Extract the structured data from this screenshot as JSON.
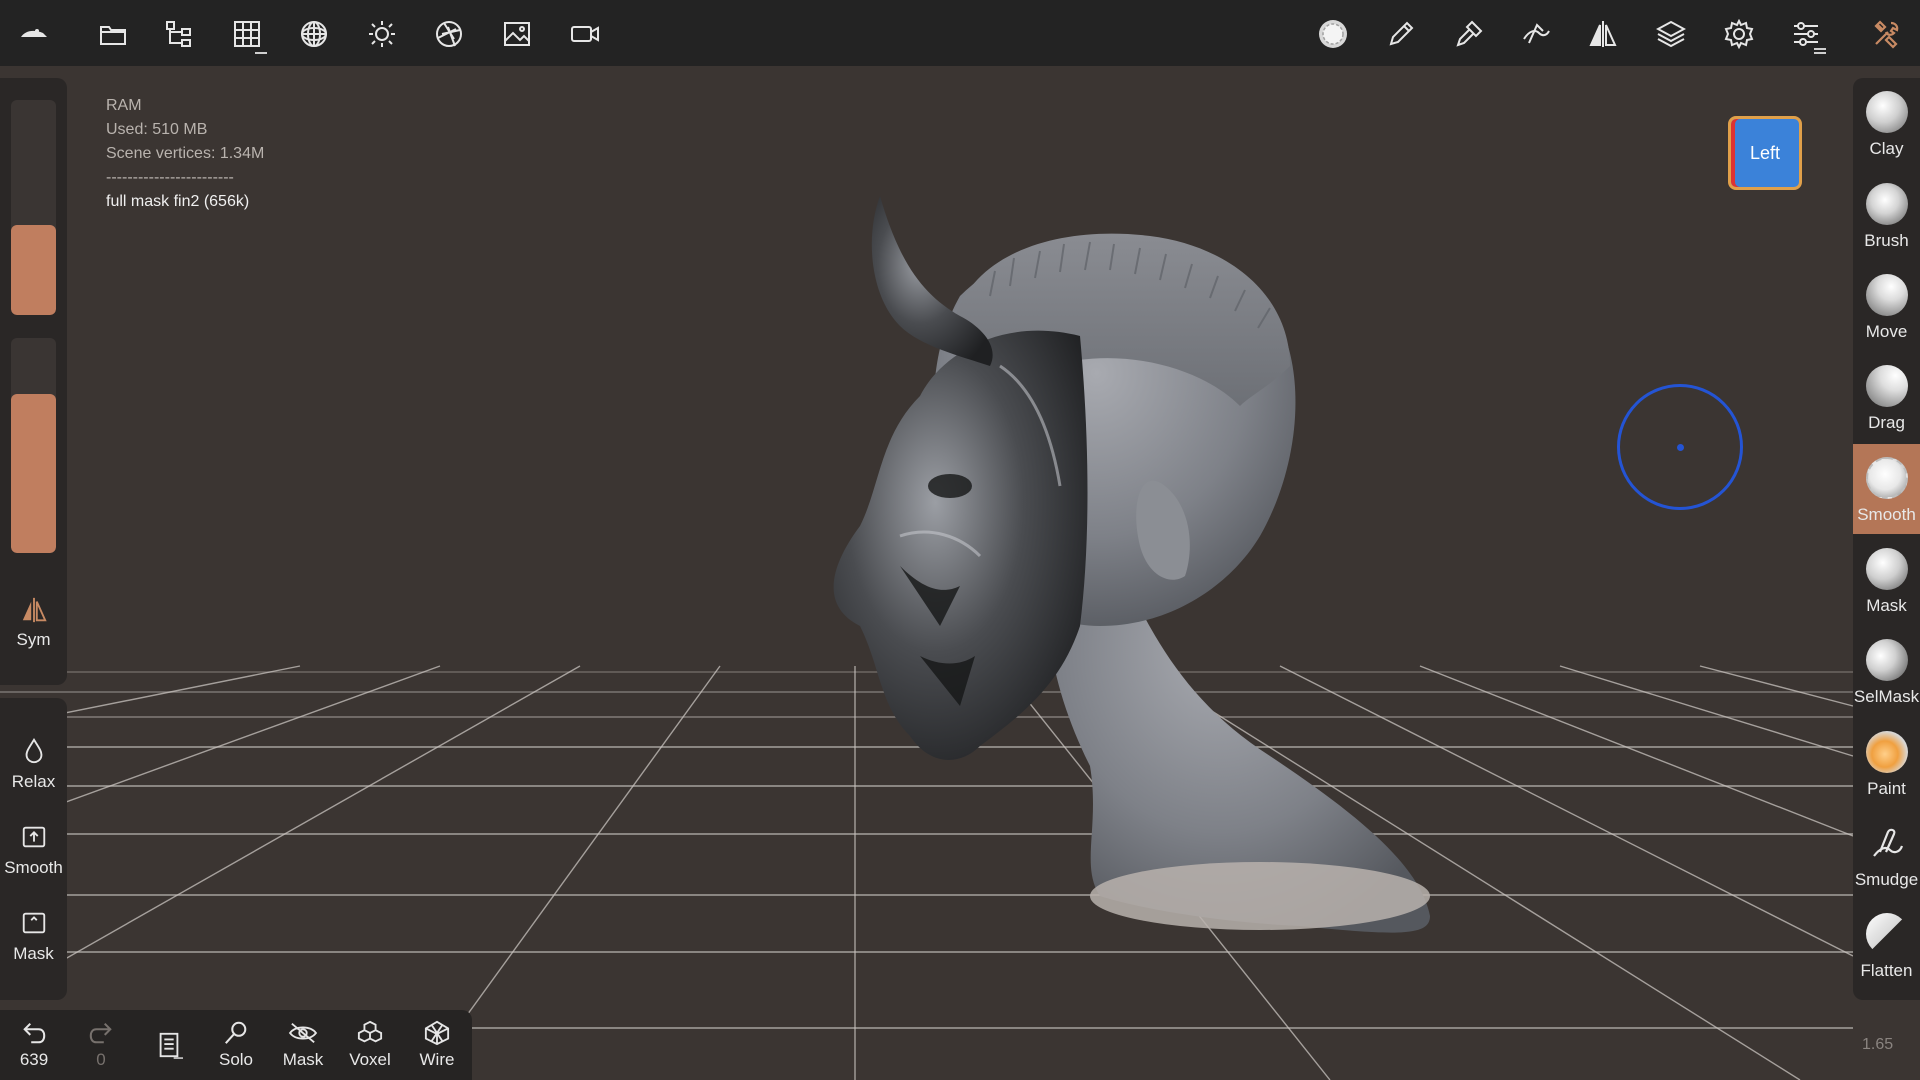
{
  "topbar": {
    "left_icons": [
      "logo-icon",
      "folder-icon",
      "scene-tree-icon",
      "grid-icon",
      "sphere-icon",
      "sun-icon",
      "aperture-icon",
      "image-icon",
      "camera-icon"
    ],
    "right_icons": [
      "brush-preview-icon",
      "pen-icon",
      "paint-icon",
      "stroke-icon",
      "symmetry-icon",
      "layers-icon",
      "gear-icon",
      "sliders-icon",
      "tools-icon"
    ]
  },
  "info": {
    "ram_label": "RAM",
    "used": "Used: 510 MB",
    "vertices": "Scene vertices: 1.34M",
    "separator": "------------------------",
    "object": "full mask fin2 (656k)"
  },
  "left": {
    "radius_level": 0.42,
    "intensity_level": 0.74,
    "sym_label": "Sym",
    "relax_label": "Relax",
    "smooth_label": "Smooth",
    "mask_label": "Mask"
  },
  "bottom": {
    "undo_count": "639",
    "redo_count": "0",
    "solo_label": "Solo",
    "mask_label": "Mask",
    "voxel_label": "Voxel",
    "wire_label": "Wire"
  },
  "tools": [
    {
      "label": "Clay"
    },
    {
      "label": "Brush"
    },
    {
      "label": "Move"
    },
    {
      "label": "Drag"
    },
    {
      "label": "Smooth",
      "active": true
    },
    {
      "label": "Mask"
    },
    {
      "label": "SelMask"
    },
    {
      "label": "Paint"
    },
    {
      "label": "Smudge"
    },
    {
      "label": "Flatten"
    }
  ],
  "view_cube_label": "Left",
  "zoom_value": "1.65",
  "colors": {
    "accent": "#b47657",
    "slider_fill": "#c07e5f",
    "background": "#3b3532",
    "cursor": "#2454d4"
  }
}
